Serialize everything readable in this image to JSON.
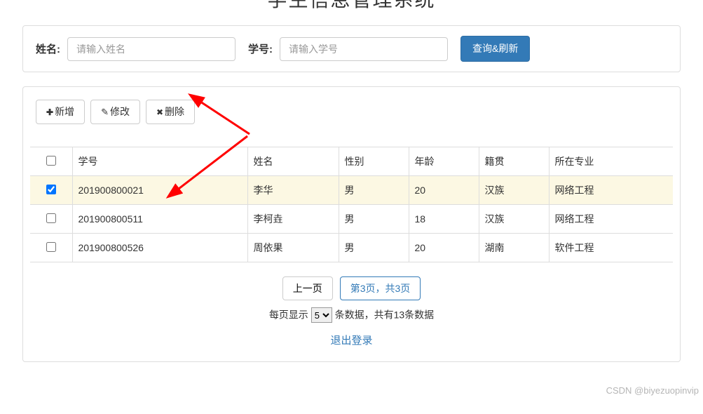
{
  "header": {
    "title_partial": "学生信息管理系统"
  },
  "search": {
    "name_label": "姓名:",
    "name_placeholder": "请输入姓名",
    "id_label": "学号:",
    "id_placeholder": "请输入学号",
    "query_button": "查询&刷新"
  },
  "toolbar": {
    "add_label": "新增",
    "edit_label": "修改",
    "delete_label": "删除"
  },
  "table": {
    "headers": {
      "checkbox": "",
      "student_id": "学号",
      "name": "姓名",
      "gender": "性别",
      "age": "年龄",
      "origin": "籍贯",
      "major": "所在专业"
    },
    "rows": [
      {
        "checked": true,
        "student_id": "201900800021",
        "name": "李华",
        "gender": "男",
        "age": "20",
        "origin": "汉族",
        "major": "网络工程"
      },
      {
        "checked": false,
        "student_id": "201900800511",
        "name": "李柯垚",
        "gender": "男",
        "age": "18",
        "origin": "汉族",
        "major": "网络工程"
      },
      {
        "checked": false,
        "student_id": "201900800526",
        "name": "周依果",
        "gender": "男",
        "age": "20",
        "origin": "湖南",
        "major": "软件工程"
      }
    ]
  },
  "pagination": {
    "prev_label": "上一页",
    "current_label": "第3页，共3页",
    "per_page_prefix": "每页显示",
    "per_page_value": "5",
    "per_page_suffix": "条数据，共有13条数据",
    "total_records": 13,
    "current_page": 3,
    "total_pages": 3
  },
  "logout": {
    "label": "退出登录"
  },
  "watermark": "CSDN @biyezuopinvip",
  "colors": {
    "primary": "#337ab7",
    "border": "#ddd",
    "row_highlight": "#fcf8e3",
    "arrow": "#ff0000"
  }
}
